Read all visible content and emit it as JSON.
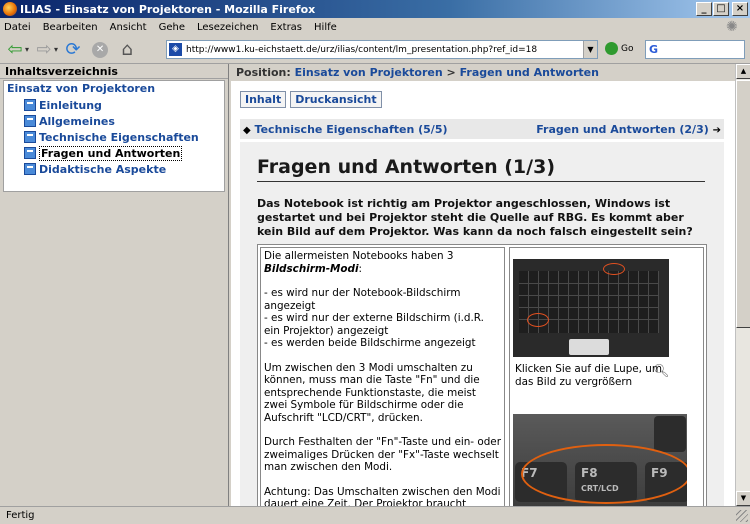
{
  "window": {
    "title": "ILIAS - Einsatz von Projektoren - Mozilla Firefox"
  },
  "menu": [
    "Datei",
    "Bearbeiten",
    "Ansicht",
    "Gehe",
    "Lesezeichen",
    "Extras",
    "Hilfe"
  ],
  "toolbar": {
    "url": "http://www1.ku-eichstaett.de/urz/ilias/content/lm_presentation.php?ref_id=18",
    "go_label": "Go",
    "search_logo": "G"
  },
  "sidebar": {
    "header": "Inhaltsverzeichnis",
    "root": "Einsatz von Projektoren",
    "items": [
      {
        "label": "Einleitung"
      },
      {
        "label": "Allgemeines"
      },
      {
        "label": "Technische Eigenschaften"
      },
      {
        "label": "Fragen und Antworten"
      },
      {
        "label": "Didaktische Aspekte"
      }
    ]
  },
  "position": {
    "label": "Position:",
    "crumb1": "Einsatz von Projektoren",
    "sep": ">",
    "crumb2": "Fragen und Antworten"
  },
  "tabs": [
    "Inhalt",
    "Druckansicht"
  ],
  "prev_link": "Technische Eigenschaften (5/5)",
  "next_link": "Fragen und Antworten (2/3)",
  "page": {
    "title": "Fragen und Antworten (1/3)",
    "intro": "Das Notebook ist richtig am Projektor angeschlossen, Windows ist gestartet und bei Projektor steht die Quelle auf RBG. Es kommt aber kein Bild auf dem Projektor. Was kann da noch falsch eingestellt sein?",
    "answer_line1": "Die allermeisten Notebooks haben 3",
    "answer_emph": "Bildschirm-Modi",
    "answer_line1_end": ":",
    "bullets": "- es wird nur der Notebook-Bildschirm angezeigt\n- es wird nur der externe Bildschirm (i.d.R. ein Projektor) angezeigt\n- es werden beide Bildschirme angezeigt",
    "para2": "Um zwischen den 3 Modi umschalten zu können, muss man die Taste \"Fn\" und die entsprechende Funktionstaste, die meist zwei Symbole für Bildschirme oder die Aufschrift \"LCD/CRT\", drücken.",
    "para3": "Durch Festhalten der \"Fn\"-Taste und ein- oder zweimaliges Drücken der \"Fx\"-Taste wechselt man zwischen den Modi.",
    "para4": "Achtung: Das Umschalten zwischen den Modi dauert eine Zeit. Der Projektor braucht einige",
    "image_caption": "Klicken Sie auf die Lupe, um das Bild zu vergrößern",
    "keys": [
      "F7",
      "F8",
      "CRT/LCD",
      "F9"
    ]
  },
  "status": "Fertig"
}
